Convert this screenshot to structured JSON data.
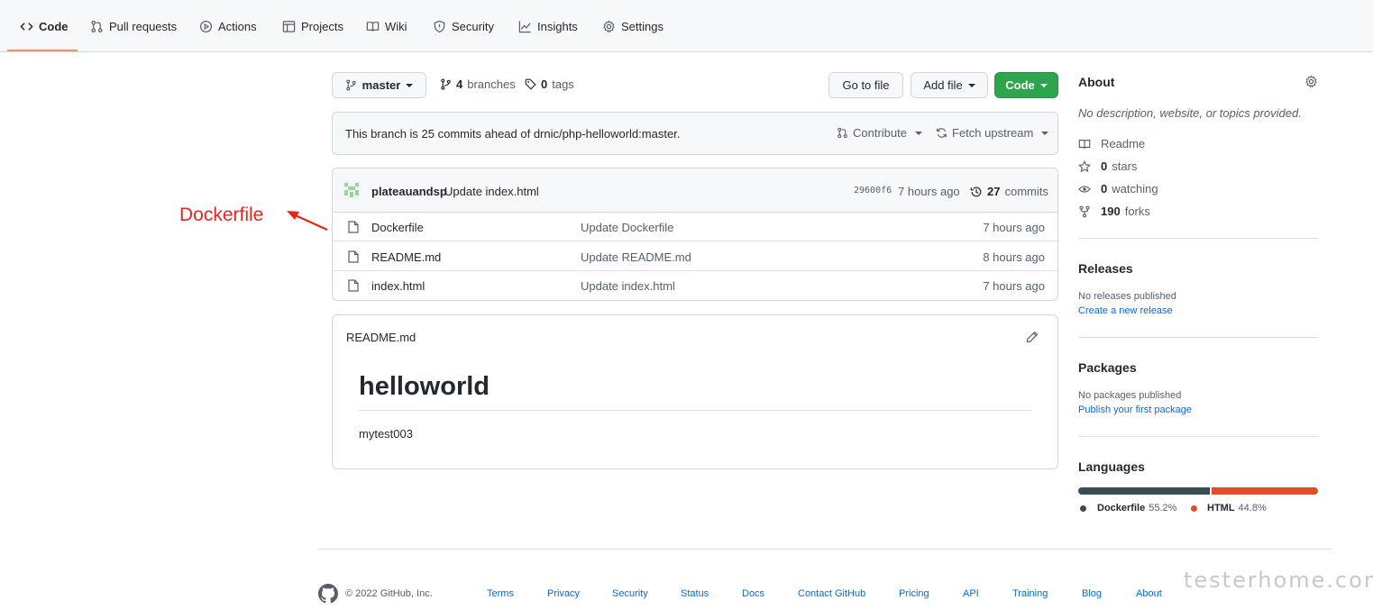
{
  "nav": {
    "tabs": [
      {
        "label": "Code",
        "icon": "code-icon"
      },
      {
        "label": "Pull requests",
        "icon": "pull-request-icon"
      },
      {
        "label": "Actions",
        "icon": "play-icon"
      },
      {
        "label": "Projects",
        "icon": "table-icon"
      },
      {
        "label": "Wiki",
        "icon": "book-icon"
      },
      {
        "label": "Security",
        "icon": "shield-icon"
      },
      {
        "label": "Insights",
        "icon": "graph-icon"
      },
      {
        "label": "Settings",
        "icon": "gear-icon"
      }
    ]
  },
  "toolbar": {
    "branch": "master",
    "branches_count": "4",
    "branches_label": "branches",
    "tags_count": "0",
    "tags_label": "tags",
    "go_to_file": "Go to file",
    "add_file": "Add file",
    "code": "Code"
  },
  "ahead": {
    "text": "This branch is 25 commits ahead of drnic/php-helloworld:master.",
    "contribute": "Contribute",
    "fetch_upstream": "Fetch upstream"
  },
  "commit": {
    "author": "plateauandsp",
    "message": "Update index.html",
    "sha": "29600f6",
    "time": "7 hours ago",
    "commits_count": "27",
    "commits_label": "commits"
  },
  "files": [
    {
      "name": "Dockerfile",
      "message": "Update Dockerfile",
      "time": "7 hours ago"
    },
    {
      "name": "README.md",
      "message": "Update README.md",
      "time": "8 hours ago"
    },
    {
      "name": "index.html",
      "message": "Update index.html",
      "time": "7 hours ago"
    }
  ],
  "annotation": {
    "text": "Dockerfile",
    "color": "#e8251b"
  },
  "readme": {
    "filename": "README.md",
    "heading": "helloworld",
    "body": "mytest003"
  },
  "about": {
    "title": "About",
    "description": "No description, website, or topics provided.",
    "readme": "Readme",
    "stars_count": "0",
    "stars_label": "stars",
    "watching_count": "0",
    "watching_label": "watching",
    "forks_count": "190",
    "forks_label": "forks"
  },
  "releases": {
    "title": "Releases",
    "none": "No releases published",
    "link": "Create a new release"
  },
  "packages": {
    "title": "Packages",
    "none": "No packages published",
    "link": "Publish your first package"
  },
  "languages": {
    "title": "Languages",
    "items": [
      {
        "name": "Dockerfile",
        "percent": "55.2%",
        "fraction": 0.552,
        "color": "#384d54"
      },
      {
        "name": "HTML",
        "percent": "44.8%",
        "fraction": 0.448,
        "color": "#e34c26"
      }
    ]
  },
  "footer": {
    "copyright": "© 2022 GitHub, Inc.",
    "links": [
      "Terms",
      "Privacy",
      "Security",
      "Status",
      "Docs",
      "Contact GitHub",
      "Pricing",
      "API",
      "Training",
      "Blog",
      "About"
    ]
  },
  "watermark": "testerhome.com"
}
